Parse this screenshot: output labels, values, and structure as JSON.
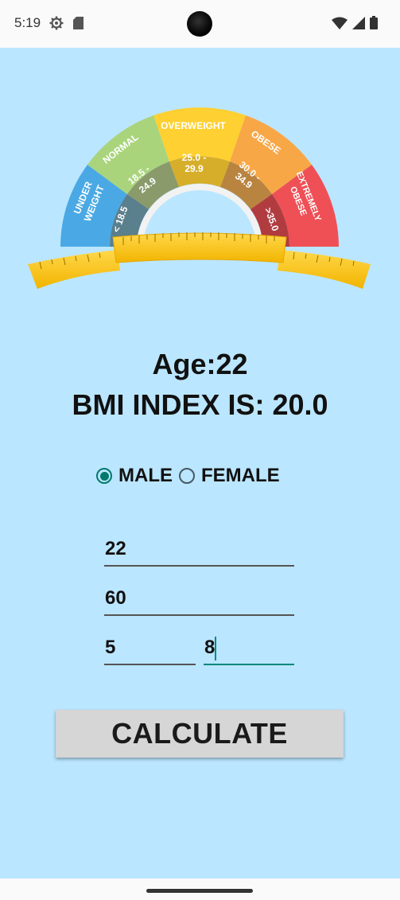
{
  "status_bar": {
    "time": "5:19",
    "left_icons": [
      "settings-icon",
      "sd-card-icon"
    ],
    "right_icons": [
      "wifi-icon",
      "signal-icon",
      "battery-icon"
    ]
  },
  "gauge": {
    "categories": [
      {
        "name": "UNDER WEIGHT",
        "range": "< 18.5",
        "color": "#4aa9e4"
      },
      {
        "name": "NORMAL",
        "range": "18.5 - 24.9",
        "color": "#a6d47a"
      },
      {
        "name": "OVERWEIGHT",
        "range": "25.0 - 29.9",
        "color": "#fed031"
      },
      {
        "name": "OBESE",
        "range": "30.0 - 34.9",
        "color": "#f7a548"
      },
      {
        "name": "EXTREMELY OBESE",
        "range": ">35.0",
        "color": "#ef4f57"
      }
    ],
    "tape_color": "#fdc218"
  },
  "result": {
    "age": "Age:22",
    "bmi": "BMI INDEX IS: 20.0"
  },
  "gender": {
    "male_label": "MALE",
    "female_label": "FEMALE",
    "selected": "MALE"
  },
  "inputs": {
    "age": "22",
    "weight": "60",
    "height_feet": "5",
    "height_inches": "8"
  },
  "button": {
    "calculate_label": "CALCULATE"
  },
  "colors": {
    "background": "#bbe6ff",
    "accent": "#00796b"
  }
}
